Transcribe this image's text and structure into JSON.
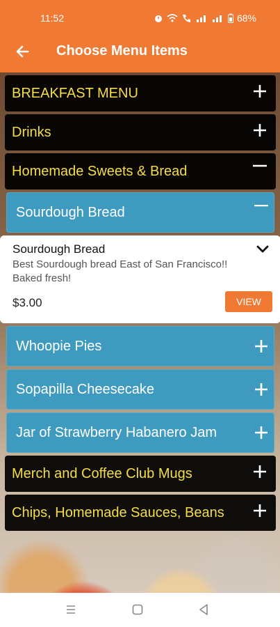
{
  "status": {
    "time": "11:52",
    "battery": "68%",
    "icons": [
      "alarm-icon",
      "wifi-icon",
      "call-icon",
      "signal-icon",
      "signal-icon",
      "battery-icon"
    ]
  },
  "appbar": {
    "title": "Choose Menu Items",
    "back_icon": "arrow-left-icon"
  },
  "colors": {
    "accent": "#F07A34",
    "category_text": "#F4DD47",
    "item_bg": "#3E9ABF"
  },
  "menu": {
    "categories": [
      {
        "label": "BREAKFAST MENU",
        "expanded": false
      },
      {
        "label": "Drinks",
        "expanded": false
      },
      {
        "label": "Homemade Sweets & Bread",
        "expanded": true
      },
      {
        "label": "Merch and Coffee Club Mugs",
        "expanded": false
      },
      {
        "label": "Chips, Homemade Sauces, Beans",
        "expanded": false
      }
    ],
    "items": [
      {
        "label": "Sourdough Bread",
        "expanded": true
      },
      {
        "label": "Whoopie Pies",
        "expanded": false
      },
      {
        "label": "Sopapilla Cheesecake",
        "expanded": false
      },
      {
        "label": "Jar of Strawberry Habanero Jam",
        "expanded": false
      }
    ],
    "detail": {
      "name": "Sourdough Bread",
      "description_line1": "Best Sourdough bread East of San Francisco!!",
      "description_line2": "Baked fresh!",
      "price": "$3.00",
      "view_label": "VIEW"
    }
  }
}
